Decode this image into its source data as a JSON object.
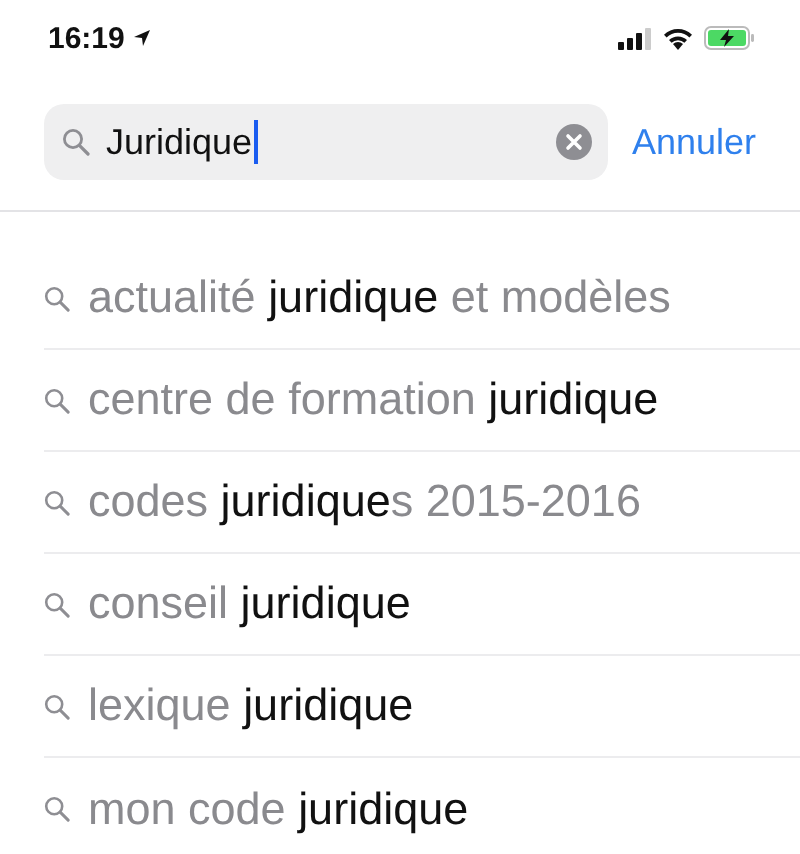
{
  "status_bar": {
    "time": "16:19"
  },
  "search": {
    "value": "Juridique",
    "cancel": "Annuler"
  },
  "suggestions": [
    {
      "parts": [
        {
          "text": "actualité ",
          "match": false
        },
        {
          "text": "juridique",
          "match": true
        },
        {
          "text": " et modèles",
          "match": false
        }
      ]
    },
    {
      "parts": [
        {
          "text": "centre de formation ",
          "match": false
        },
        {
          "text": "juridique",
          "match": true
        }
      ]
    },
    {
      "parts": [
        {
          "text": "codes ",
          "match": false
        },
        {
          "text": "juridique",
          "match": true
        },
        {
          "text": "s 2015-2016",
          "match": false
        }
      ]
    },
    {
      "parts": [
        {
          "text": "conseil ",
          "match": false
        },
        {
          "text": "juridique",
          "match": true
        }
      ]
    },
    {
      "parts": [
        {
          "text": "lexique ",
          "match": false
        },
        {
          "text": "juridique",
          "match": true
        }
      ]
    },
    {
      "parts": [
        {
          "text": "mon code ",
          "match": false
        },
        {
          "text": "juridique",
          "match": true
        }
      ]
    }
  ]
}
